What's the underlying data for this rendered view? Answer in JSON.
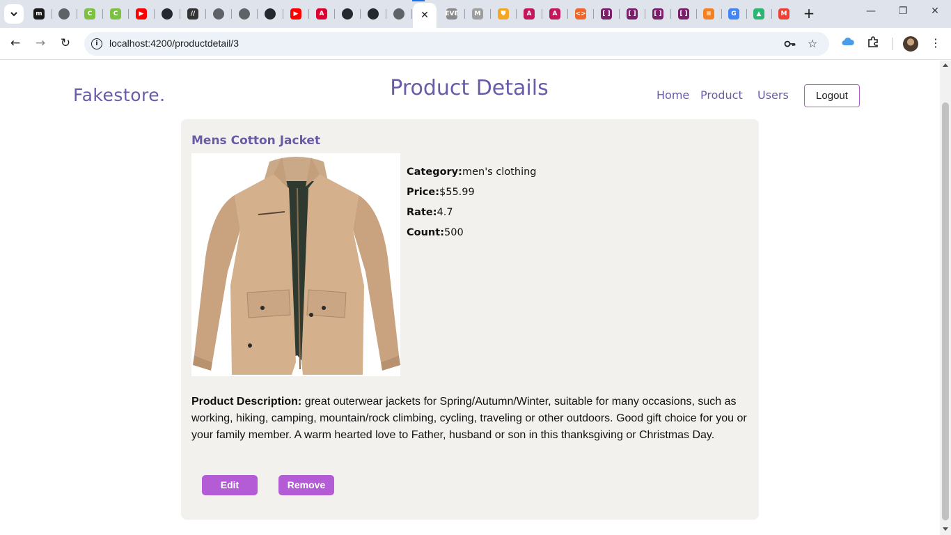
{
  "browser": {
    "tabs": [
      {
        "icon": "m-icon",
        "color": "#1a1a1a",
        "glyph": "m"
      },
      {
        "icon": "globe-icon",
        "color": "#5f6368",
        "glyph": ""
      },
      {
        "icon": "c-icon",
        "color": "#7cc142",
        "glyph": "C"
      },
      {
        "icon": "c-icon",
        "color": "#7cc142",
        "glyph": "C"
      },
      {
        "icon": "youtube-icon",
        "color": "#ff0000",
        "glyph": "▶"
      },
      {
        "icon": "github-icon",
        "color": "#24292f",
        "glyph": ""
      },
      {
        "icon": "slash-icon",
        "color": "#333333",
        "glyph": "//"
      },
      {
        "icon": "globe-icon",
        "color": "#5f6368",
        "glyph": ""
      },
      {
        "icon": "globe-icon",
        "color": "#5f6368",
        "glyph": ""
      },
      {
        "icon": "github-icon",
        "color": "#24292f",
        "glyph": ""
      },
      {
        "icon": "youtube-icon",
        "color": "#ff0000",
        "glyph": "▶"
      },
      {
        "icon": "angular-icon",
        "color": "#dd0031",
        "glyph": "A"
      },
      {
        "icon": "github-icon",
        "color": "#24292f",
        "glyph": ""
      },
      {
        "icon": "github-icon",
        "color": "#24292f",
        "glyph": ""
      },
      {
        "icon": "globe-icon",
        "color": "#5f6368",
        "glyph": ""
      },
      {
        "icon": "eve-icon",
        "color": "#8a8a8a",
        "glyph": "EVE"
      },
      {
        "icon": "m-icon",
        "color": "#9e9e9e",
        "glyph": "M"
      },
      {
        "icon": "shield-icon",
        "color": "#f5a623",
        "glyph": "⛊"
      },
      {
        "icon": "angular-icon",
        "color": "#c2185b",
        "glyph": "A"
      },
      {
        "icon": "angular-icon",
        "color": "#c2185b",
        "glyph": "A"
      },
      {
        "icon": "stackblitz-icon",
        "color": "#f06529",
        "glyph": "<>"
      },
      {
        "icon": "dev-icon",
        "color": "#7b1f6a",
        "glyph": "[ ]"
      },
      {
        "icon": "dev-icon",
        "color": "#7b1f6a",
        "glyph": "[ ]"
      },
      {
        "icon": "dev-icon",
        "color": "#7b1f6a",
        "glyph": "[ ]"
      },
      {
        "icon": "dev-icon",
        "color": "#7b1f6a",
        "glyph": "[ ]"
      },
      {
        "icon": "stackoverflow-icon",
        "color": "#f48024",
        "glyph": "≡"
      },
      {
        "icon": "google-icon",
        "color": "#4285f4",
        "glyph": "G"
      },
      {
        "icon": "mountain-icon",
        "color": "#2bb673",
        "glyph": "▲"
      },
      {
        "icon": "gmail-icon",
        "color": "#ea4335",
        "glyph": "M"
      }
    ],
    "active_tab_close": "✕",
    "new_tab": "+",
    "url": "localhost:4200/productdetail/3"
  },
  "page": {
    "brand": "Fakestore.",
    "title": "Product Details",
    "nav": {
      "home": "Home",
      "product": "Product",
      "users": "Users",
      "logout": "Logout"
    }
  },
  "product": {
    "name": "Mens Cotton Jacket",
    "category_label": "Category",
    "category": "men's clothing",
    "price_label": "Price",
    "price": "$55.99",
    "rate_label": "Rate",
    "rate": "4.7",
    "count_label": "Count",
    "count": "500",
    "description_label": "Product Description:",
    "description": "great outerwear jackets for Spring/Autumn/Winter, suitable for many occasions, such as working, hiking, camping, mountain/rock climbing, cycling, traveling or other outdoors. Good gift choice for you or your family member. A warm hearted love to Father, husband or son in this thanksgiving or Christmas Day."
  },
  "actions": {
    "edit": "Edit",
    "remove": "Remove"
  },
  "colors": {
    "accent": "#6a5aa8",
    "button": "#b35cd6",
    "card_bg": "#f2f1ee"
  }
}
